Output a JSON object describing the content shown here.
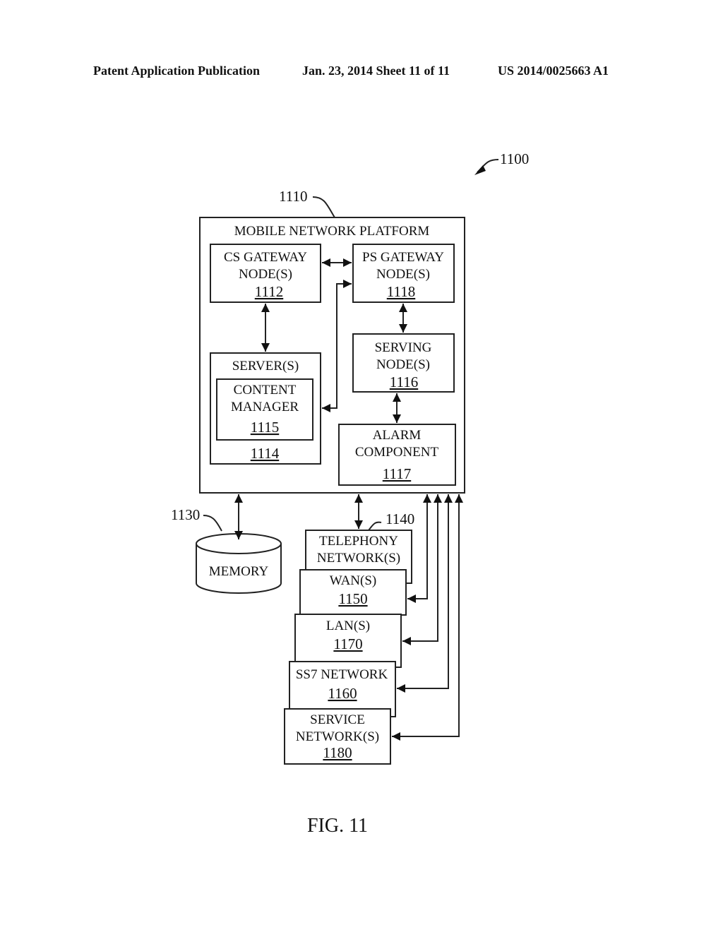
{
  "header": {
    "left": "Patent Application Publication",
    "date_sheet": "Jan. 23, 2014  Sheet 11 of 11",
    "number": "US 2014/0025663 A1"
  },
  "figure": {
    "ref": "1100",
    "caption": "FIG. 11"
  },
  "platform": {
    "ref": "1110",
    "title": "MOBILE NETWORK PLATFORM",
    "cs_gateway": {
      "line1": "CS GATEWAY",
      "line2": "NODE(S)",
      "ref": "1112"
    },
    "ps_gateway": {
      "line1": "PS GATEWAY",
      "line2": "NODE(S)",
      "ref": "1118"
    },
    "servers": {
      "title": "SERVER(S)",
      "ref": "1114"
    },
    "content_manager": {
      "line1": "CONTENT",
      "line2": "MANAGER",
      "ref": "1115"
    },
    "serving_node": {
      "line1": "SERVING",
      "line2": "NODE(S)",
      "ref": "1116"
    },
    "alarm": {
      "line1": "ALARM",
      "line2": "COMPONENT",
      "ref": "1117"
    }
  },
  "memory": {
    "ref": "1130",
    "label": "MEMORY"
  },
  "networks": {
    "telephony": {
      "line1": "TELEPHONY",
      "line2": "NETWORK(S)",
      "ref": "1140"
    },
    "wan": {
      "line1": "WAN(S)",
      "ref": "1150"
    },
    "lan": {
      "line1": "LAN(S)",
      "ref": "1170"
    },
    "ss7": {
      "line1": "SS7 NETWORK",
      "ref": "1160"
    },
    "service": {
      "line1": "SERVICE",
      "line2": "NETWORK(S)",
      "ref": "1180"
    }
  }
}
